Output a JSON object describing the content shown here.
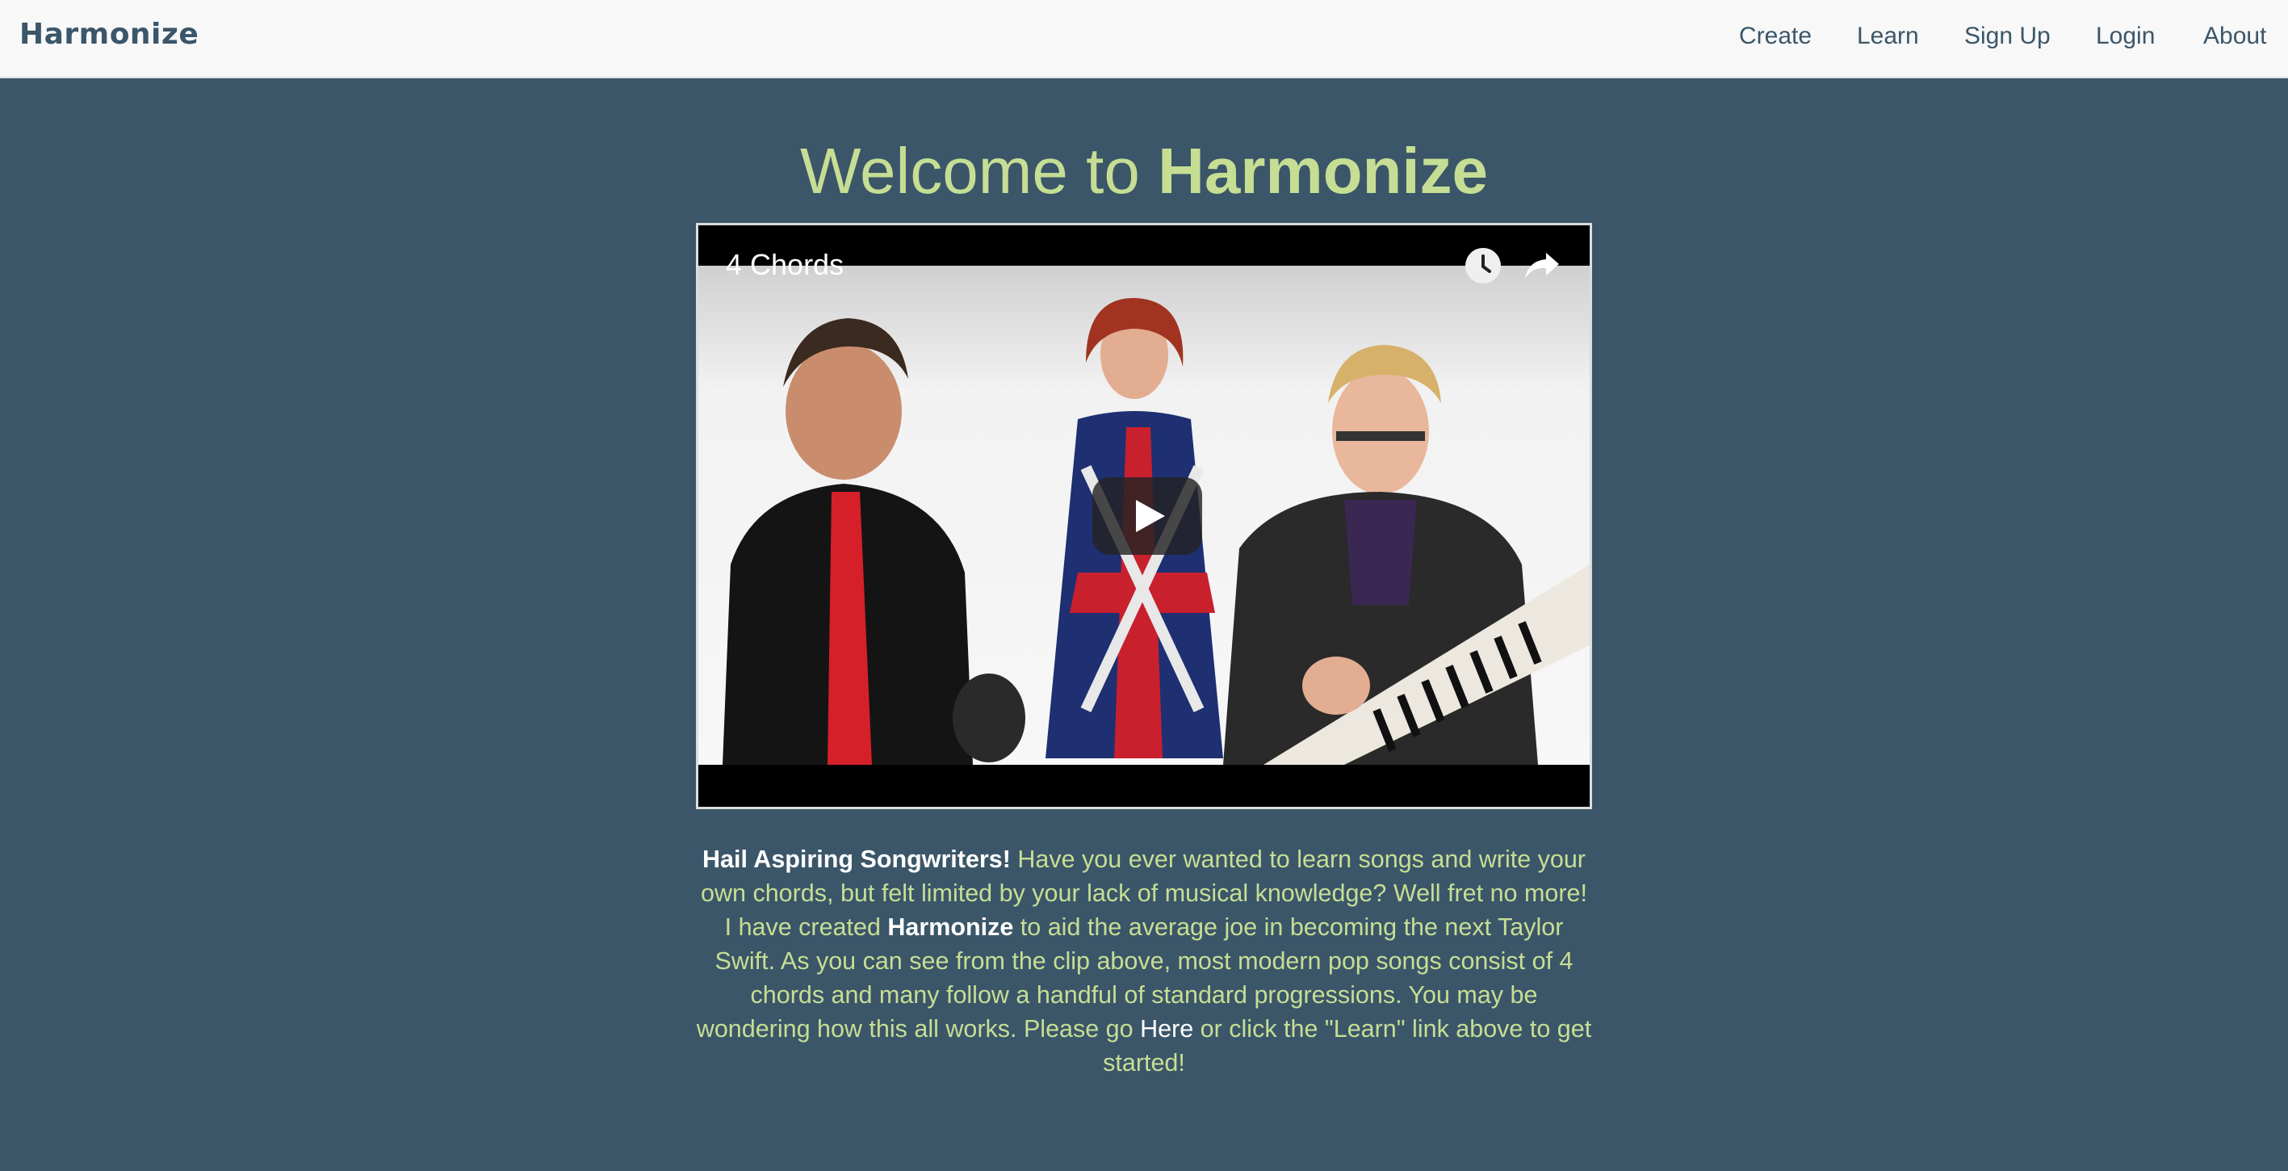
{
  "navbar": {
    "brand": "Harmonize",
    "links": [
      {
        "label": "Create"
      },
      {
        "label": "Learn"
      },
      {
        "label": "Sign Up"
      },
      {
        "label": "Login"
      },
      {
        "label": "About"
      }
    ]
  },
  "hero": {
    "title_prefix": "Welcome to ",
    "title_emphasis": "Harmonize"
  },
  "video": {
    "title": "4 Chords",
    "icons": [
      "clock-icon",
      "share-icon",
      "play-icon"
    ]
  },
  "intro": {
    "lead": "Hail Aspiring Songwriters!",
    "text1": " Have you ever wanted to learn songs and write your own chords, but felt limited by your lack of musical knowledge? Well fret no more! I have created ",
    "brand": "Harmonize",
    "text2": " to aid the average joe in becoming the next Taylor Swift. As you can see from the clip above, most modern pop songs consist of 4 chords and many follow a handful of standard progressions. You may be wondering how this all works. Please go ",
    "link": "Here",
    "text3": " or click the \"Learn\" link above to get started!"
  },
  "colors": {
    "background": "#3b5669",
    "navbar": "#f8f8f8",
    "accent": "#c6de94",
    "nav_text": "#3b5669"
  }
}
